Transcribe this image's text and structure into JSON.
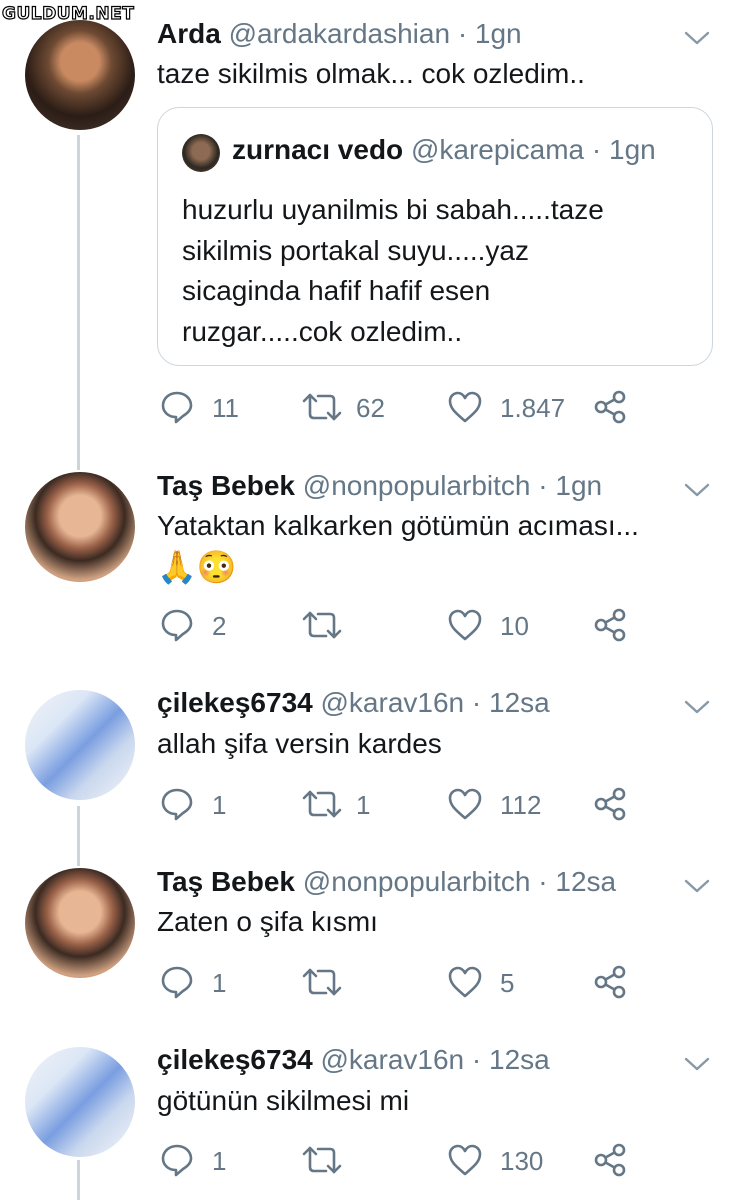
{
  "watermark": "GULDUM.NET",
  "tweets": [
    {
      "name": "Arda",
      "handle": "@ardakardashian",
      "time": "· 1gn",
      "text": "taze sikilmis olmak... cok ozledim..",
      "quote": {
        "name": "zurnacı vedo",
        "handle": "@karepicama",
        "time": "· 1gn",
        "text": "huzurlu uyanilmis bi sabah.....taze\nsikilmis portakal suyu.....yaz\nsicaginda hafif hafif esen\nruzgar.....cok ozledim.."
      },
      "replies": "11",
      "retweets": "62",
      "likes": "1.847"
    },
    {
      "name": "Taş Bebek",
      "handle": "@nonpopularbitch",
      "time": "· 1gn",
      "text": "Yataktan kalkarken götümün acıması...",
      "emoji": "🙏😳",
      "replies": "2",
      "retweets": "",
      "likes": "10"
    },
    {
      "name": "çilekeş6734",
      "handle": "@karav16n",
      "time": "· 12sa",
      "text": "allah şifa versin kardes",
      "replies": "1",
      "retweets": "1",
      "likes": "112"
    },
    {
      "name": "Taş Bebek",
      "handle": "@nonpopularbitch",
      "time": "· 12sa",
      "text": "Zaten o şifa kısmı",
      "replies": "1",
      "retweets": "",
      "likes": "5"
    },
    {
      "name": "çilekeş6734",
      "handle": "@karav16n",
      "time": "· 12sa",
      "text": "götünün sikilmesi mi",
      "replies": "1",
      "retweets": "",
      "likes": "130"
    }
  ],
  "colors": {
    "text": "#14171a",
    "secondary": "#657786",
    "border": "#ccd6dd",
    "thread": "#cdd5dc"
  },
  "icons": [
    "reply-icon",
    "retweet-icon",
    "like-icon",
    "share-icon",
    "chevron-down-icon"
  ]
}
